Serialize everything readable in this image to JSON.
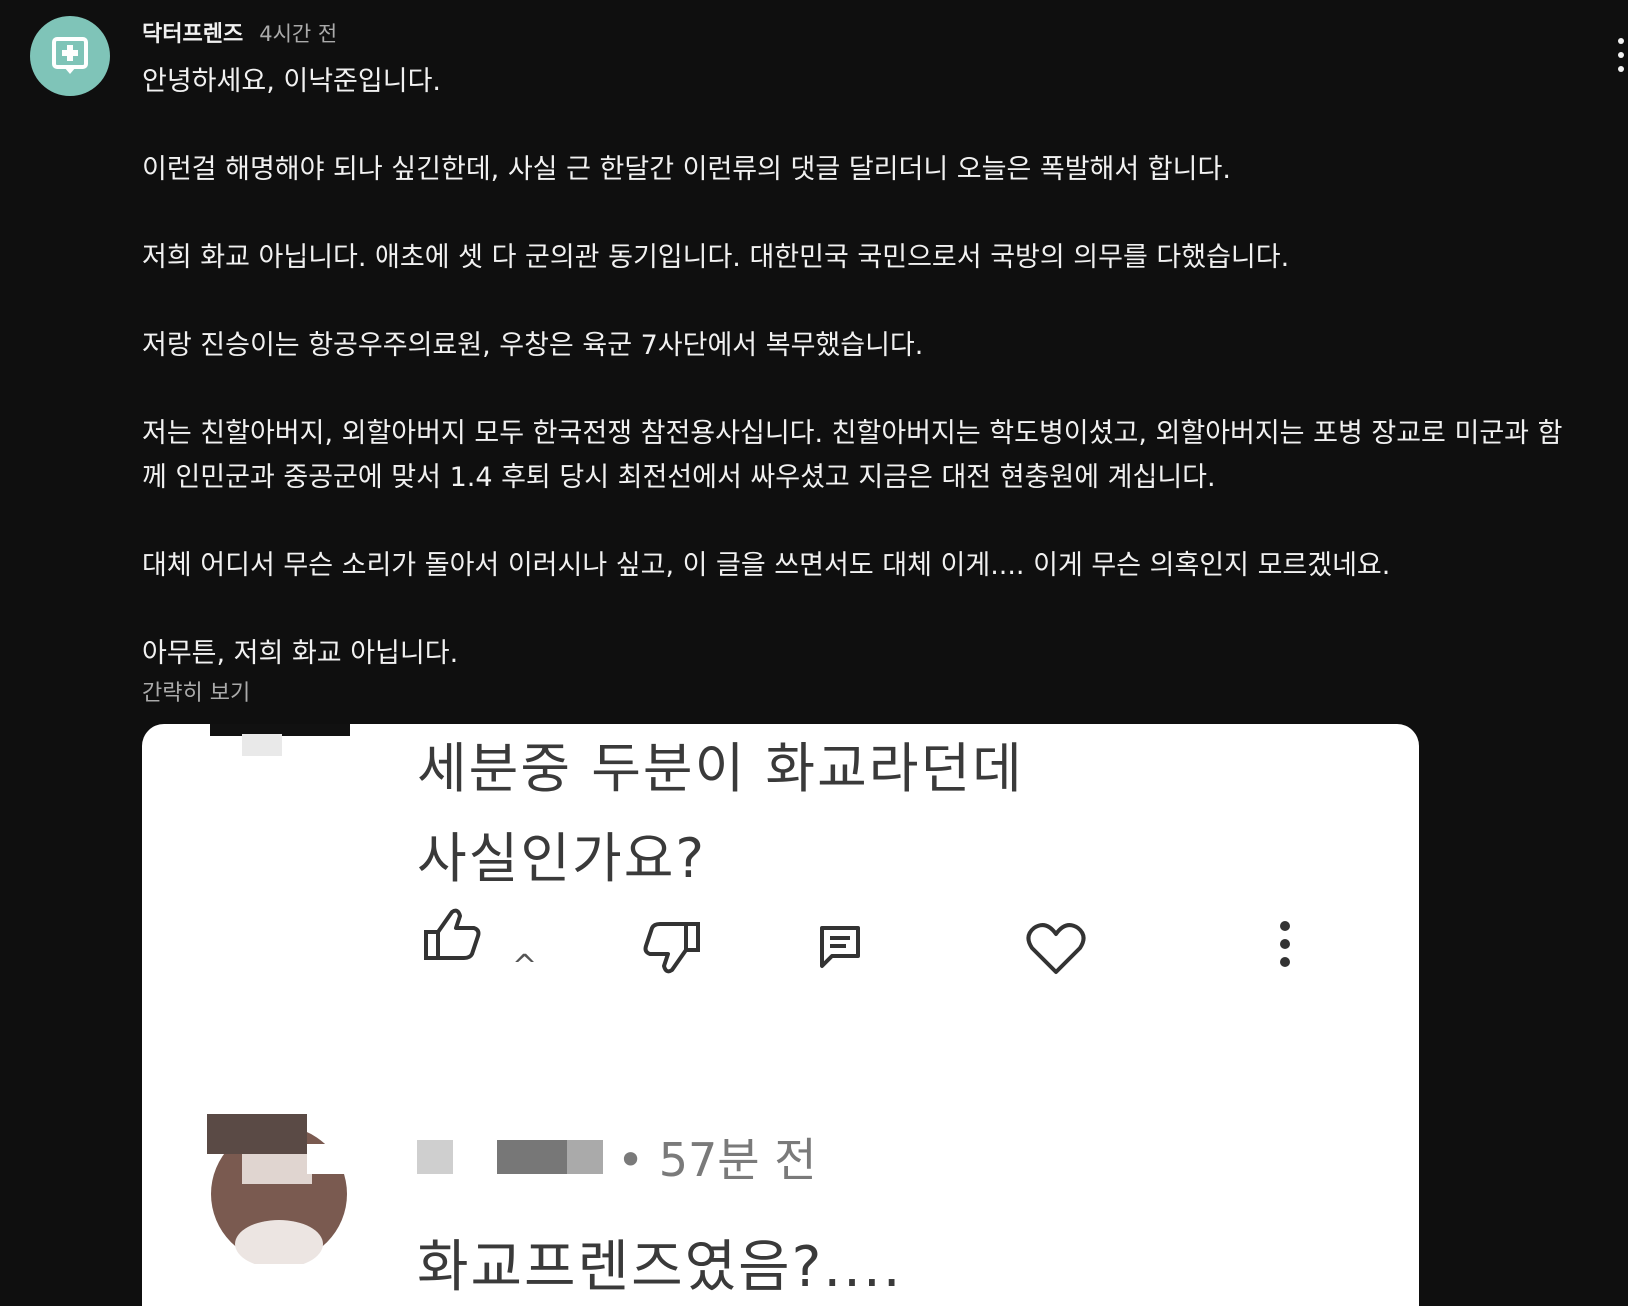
{
  "comment": {
    "author": "닥터프렌즈",
    "timestamp": "4시간 전",
    "paragraphs": [
      "안녕하세요, 이낙준입니다.",
      "이런걸 해명해야 되나 싶긴한데, 사실 근 한달간 이런류의 댓글 달리더니 오늘은 폭발해서 합니다.",
      "저희 화교 아닙니다. 애초에 셋 다 군의관 동기입니다. 대한민국 국민으로서 국방의 의무를 다했습니다.",
      "저랑 진승이는 항공우주의료원, 우창은 육군 7사단에서 복무했습니다.",
      "저는 친할아버지, 외할아버지 모두 한국전쟁 참전용사십니다. 친할아버지는 학도병이셨고, 외할아버지는 포병 장교로 미군과 함께 인민군과 중공군에 맞서 1.4 후퇴 당시 최전선에서 싸우셨고 지금은 대전 현충원에 계십니다.",
      "대체 어디서 무슨 소리가 돌아서 이러시나 싶고, 이 글을 쓰면서도 대체 이게.... 이게 무슨 의혹인지 모르겠네요.",
      "아무튼, 저희 화교 아닙니다."
    ],
    "show_less": "간략히 보기"
  },
  "screenshot": {
    "line1": "세분중 두분이 화교라던데",
    "line2": "사실인가요?",
    "like_count": "^",
    "reply_time": "• 57분 전",
    "reply_text": "화교프렌즈였음?....",
    "icons": [
      "thumbs-up-icon",
      "thumbs-down-icon",
      "reply-icon",
      "heart-icon",
      "more-vertical-icon"
    ]
  },
  "colors": {
    "background": "#0f0f0f",
    "avatar": "#7fc4b8",
    "text": "#f1f1f1",
    "secondary_text": "#aaaaaa"
  }
}
